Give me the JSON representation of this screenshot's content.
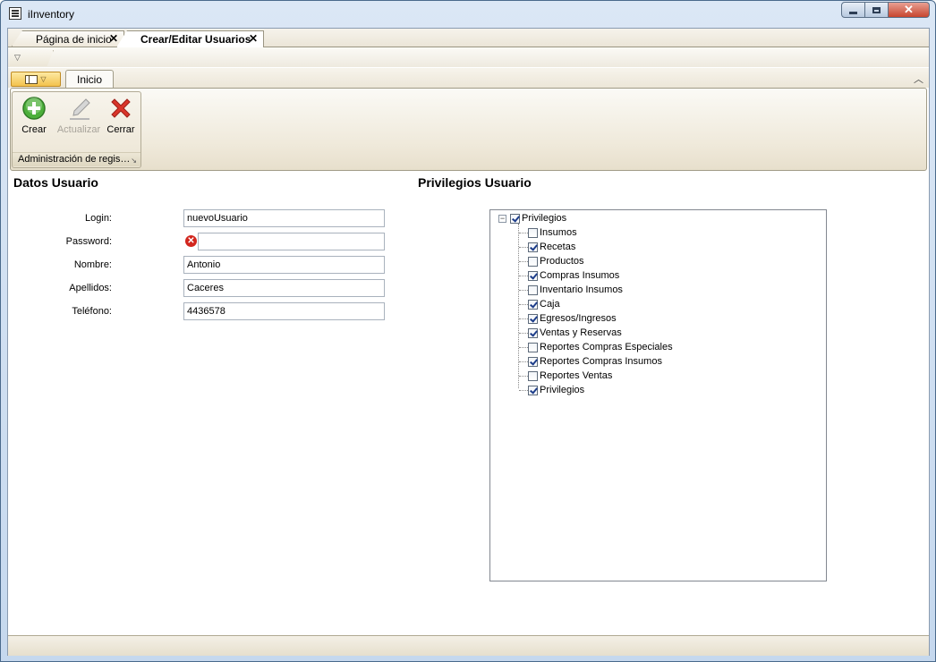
{
  "window": {
    "title": "iInventory"
  },
  "doc_tabs": [
    {
      "label": "Página de inicio"
    },
    {
      "label": "Crear/Editar Usuarios"
    }
  ],
  "ribbon": {
    "tab_label": "Inicio",
    "buttons": {
      "crear": "Crear",
      "actualizar": "Actualizar",
      "cerrar": "Cerrar"
    },
    "group_label": "Administración de regis…"
  },
  "form": {
    "title": "Datos Usuario",
    "fields": [
      {
        "label": "Login:",
        "value": "nuevoUsuario"
      },
      {
        "label": "Password:",
        "value": ""
      },
      {
        "label": "Nombre:",
        "value": "Antonio"
      },
      {
        "label": "Apellidos:",
        "value": "Caceres"
      },
      {
        "label": "Teléfono:",
        "value": "4436578"
      }
    ],
    "password_error_icon": "error-icon"
  },
  "privileges": {
    "title": "Privilegios Usuario",
    "root": {
      "label": "Privilegios",
      "checked": true,
      "expanded": true
    },
    "items": [
      {
        "label": "Insumos",
        "checked": false
      },
      {
        "label": "Recetas",
        "checked": true
      },
      {
        "label": "Productos",
        "checked": false
      },
      {
        "label": "Compras Insumos",
        "checked": true
      },
      {
        "label": "Inventario Insumos",
        "checked": false
      },
      {
        "label": "Caja",
        "checked": true
      },
      {
        "label": "Egresos/Ingresos",
        "checked": true
      },
      {
        "label": "Ventas y Reservas",
        "checked": true
      },
      {
        "label": "Reportes Compras Especiales",
        "checked": false
      },
      {
        "label": "Reportes Compras Insumos",
        "checked": true
      },
      {
        "label": "Reportes Ventas",
        "checked": false
      },
      {
        "label": "Privilegios",
        "checked": true
      }
    ]
  },
  "colors": {
    "accent_error": "#d2261e",
    "crear_green": "#4caf3a",
    "cerrar_red": "#d9352a"
  }
}
